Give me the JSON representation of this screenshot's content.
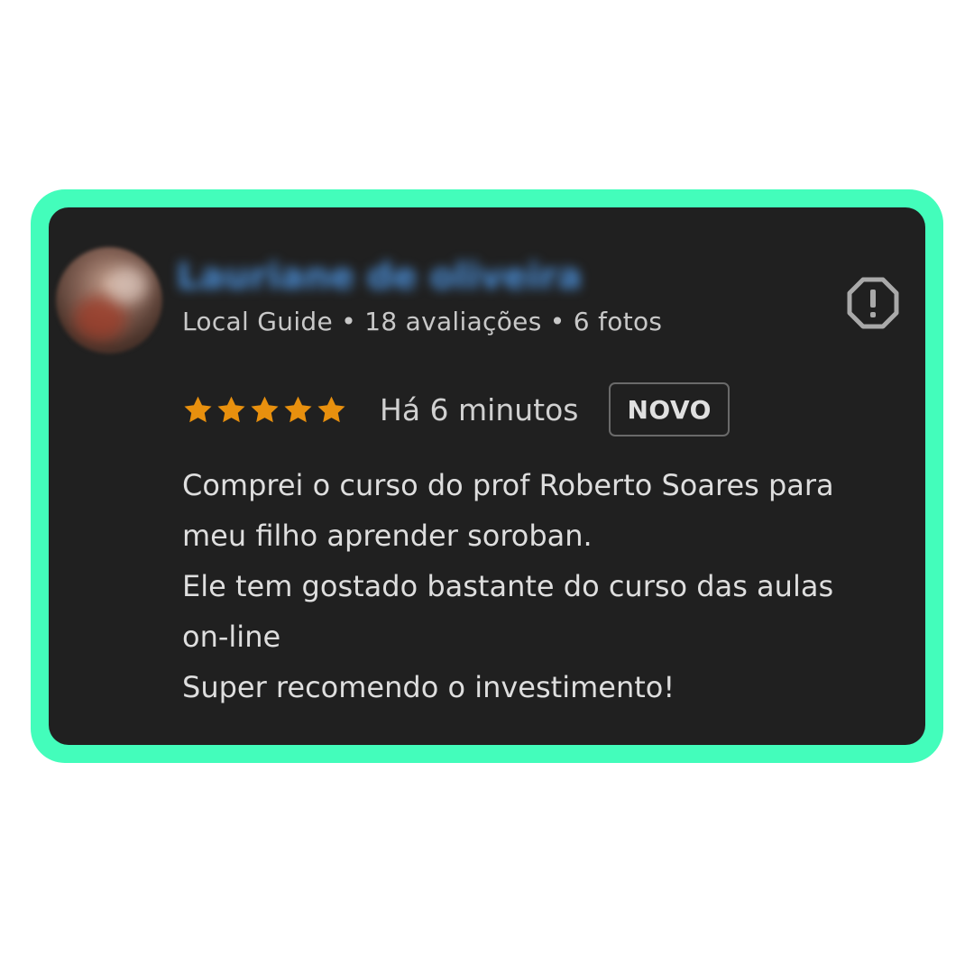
{
  "review": {
    "author_name": "Lauriane de oliveira",
    "author_meta": "Local Guide • 18 avaliações • 6 fotos",
    "rating": 5,
    "rating_max": 5,
    "time_ago": "Há 6 minutos",
    "badge": "NOVO",
    "text_lines": [
      "Comprei o curso do prof Roberto Soares para",
      "meu filho aprender soroban.",
      "Ele tem gostado bastante do curso das aulas",
      "on-line",
      "Super recomendo o investimento!"
    ],
    "report_icon": "report-octagon-icon"
  },
  "colors": {
    "frame": "#43fdbb",
    "card_background": "#202020",
    "star": "#e8900e",
    "author_name": "#4b8fd8"
  }
}
